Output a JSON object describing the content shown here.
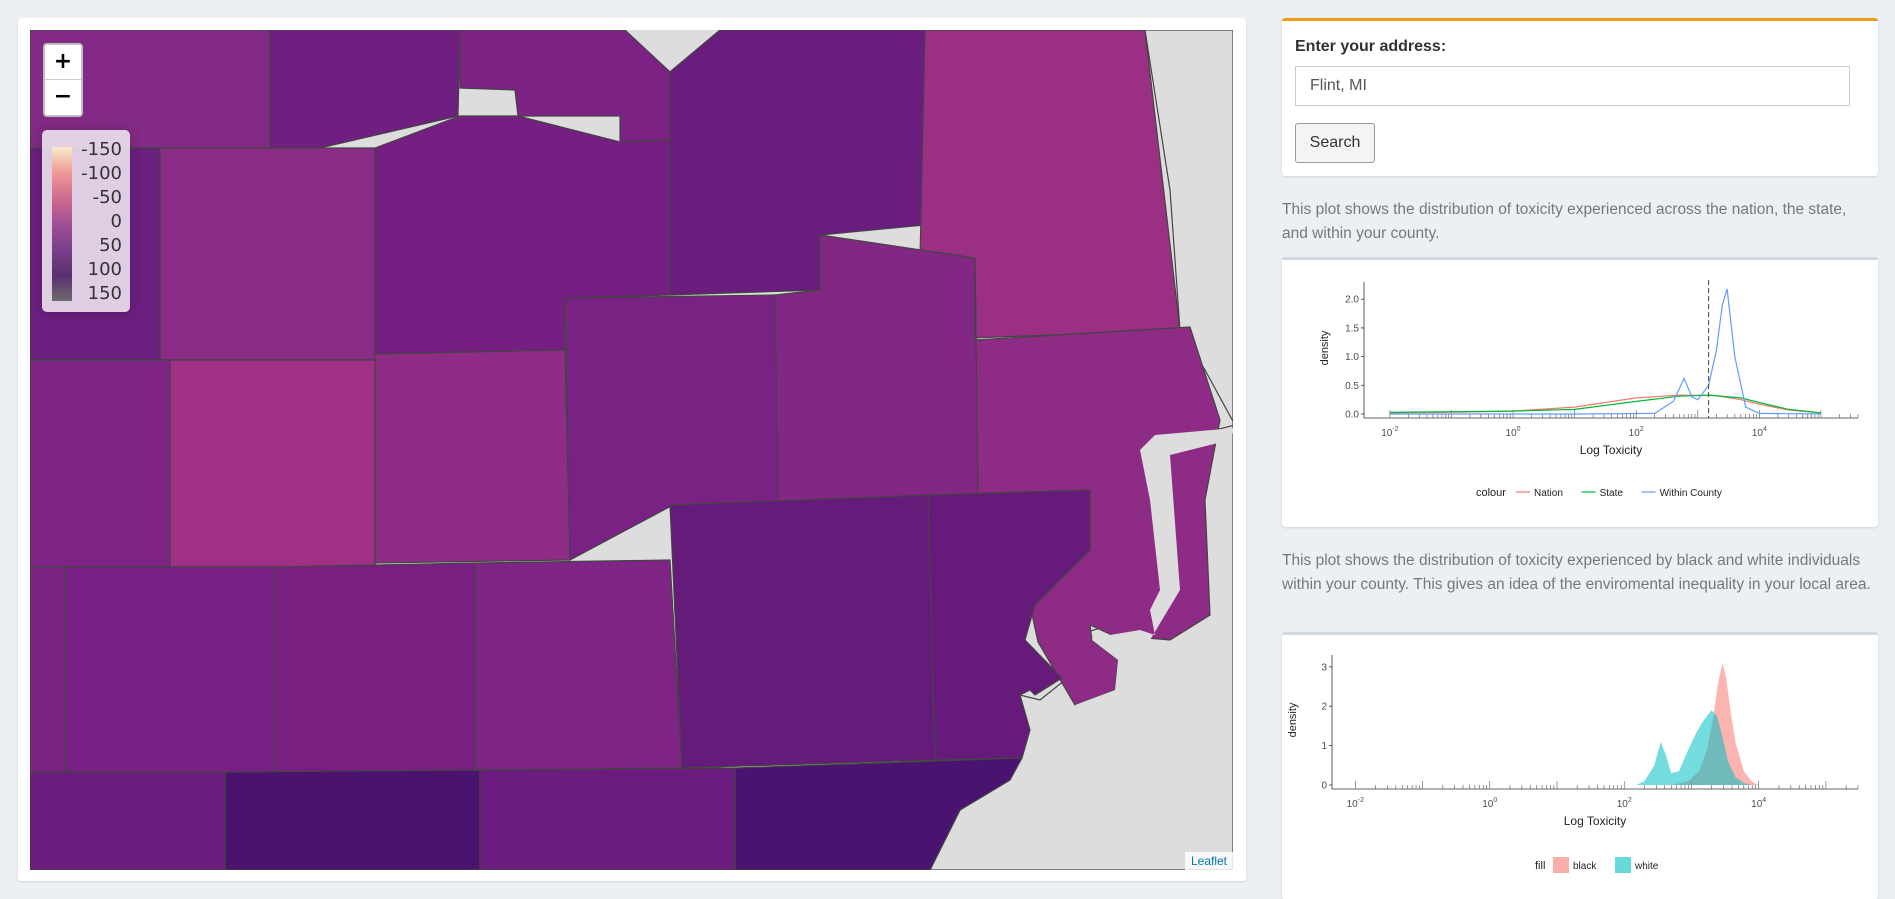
{
  "map": {
    "zoom_in_label": "+",
    "zoom_out_label": "−",
    "legend": {
      "labels": [
        "-150",
        "-100",
        "-50",
        "0",
        "50",
        "100",
        "150"
      ],
      "colors_top_to_bottom": [
        "#f7ebc8",
        "#ee9a97",
        "#cf6b8e",
        "#a14f95",
        "#7b3f8b",
        "#5a2f72",
        "#6b6b6b"
      ]
    },
    "attribution": "Leaflet"
  },
  "search": {
    "label": "Enter your address:",
    "input_value": "Flint, MI",
    "button_label": "Search"
  },
  "plot1": {
    "description": "This plot shows the distribution of toxicity experienced across the nation, the state, and within your county.",
    "chart_data": {
      "type": "line",
      "xlabel": "Log Toxicity",
      "ylabel": "density",
      "x_scale": "log10",
      "x_ticks": [
        "10^-2",
        "10^0",
        "10^2",
        "10^4"
      ],
      "y_ticks": [
        "0.0",
        "0.5",
        "1.0",
        "1.5",
        "2.0"
      ],
      "ylim": [
        0,
        2.3
      ],
      "legend_title": "colour",
      "legend_position": "bottom",
      "series": [
        {
          "name": "Nation",
          "color": "#f8766d",
          "x": [
            0.01,
            0.1,
            1,
            10,
            100,
            500,
            2000,
            5000,
            10000,
            30000,
            100000
          ],
          "y": [
            0.02,
            0.03,
            0.05,
            0.12,
            0.28,
            0.33,
            0.32,
            0.25,
            0.17,
            0.07,
            0.02
          ]
        },
        {
          "name": "State",
          "color": "#00ba38",
          "x": [
            0.01,
            0.1,
            1,
            10,
            100,
            500,
            1500,
            5000,
            10000,
            30000,
            100000
          ],
          "y": [
            0.03,
            0.04,
            0.05,
            0.08,
            0.22,
            0.31,
            0.33,
            0.28,
            0.2,
            0.08,
            0.02
          ]
        },
        {
          "name": "Within County",
          "color": "#619cff",
          "x": [
            0.01,
            10,
            200,
            400,
            600,
            800,
            1000,
            1500,
            2000,
            2500,
            3000,
            4000,
            6000,
            10000,
            100000
          ],
          "y": [
            0.0,
            0.0,
            0.01,
            0.22,
            0.62,
            0.3,
            0.25,
            0.5,
            1.1,
            1.9,
            2.18,
            1.0,
            0.12,
            0.01,
            0.0
          ]
        }
      ],
      "vline_x": 1500
    }
  },
  "plot2": {
    "description": "This plot shows the distribution of toxicity experienced by black and white individuals within your county. This gives an idea of the enviromental inequality in your local area.",
    "chart_data": {
      "type": "area",
      "xlabel": "Log Toxicity",
      "ylabel": "density",
      "x_scale": "log10",
      "x_ticks": [
        "10^-2",
        "10^0",
        "10^2",
        "10^4"
      ],
      "y_ticks": [
        "0",
        "1",
        "2",
        "3"
      ],
      "ylim": [
        0,
        3.3
      ],
      "legend_title": "fill",
      "legend_position": "bottom",
      "series": [
        {
          "name": "black",
          "color": "#f8766d",
          "x": [
            500,
            900,
            1300,
            1700,
            2100,
            2500,
            2900,
            3300,
            3800,
            4500,
            6000,
            8000,
            10000
          ],
          "y": [
            0.0,
            0.1,
            0.35,
            0.9,
            1.7,
            2.6,
            3.1,
            2.7,
            1.9,
            1.1,
            0.35,
            0.08,
            0.0
          ]
        },
        {
          "name": "white",
          "color": "#00bfc4",
          "x": [
            150,
            200,
            280,
            350,
            420,
            500,
            650,
            900,
            1200,
            1600,
            2000,
            2400,
            2900,
            3500,
            4500,
            6000,
            8000
          ],
          "y": [
            0.0,
            0.1,
            0.5,
            1.1,
            0.75,
            0.3,
            0.35,
            0.9,
            1.35,
            1.7,
            1.9,
            1.75,
            1.2,
            0.6,
            0.2,
            0.05,
            0.0
          ]
        }
      ]
    }
  }
}
